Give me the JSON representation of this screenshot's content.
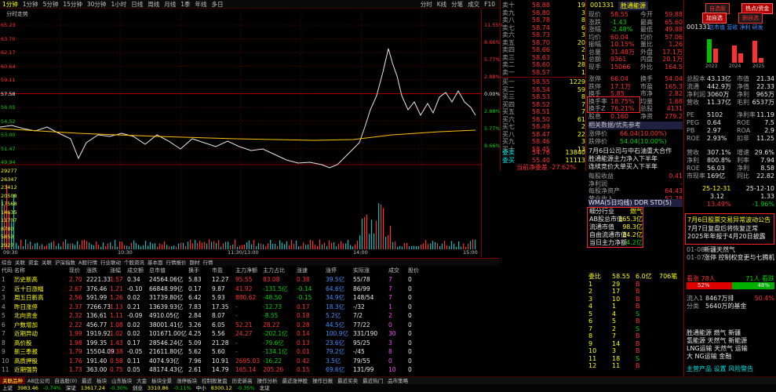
{
  "toolbar": {
    "left_items": [
      "1分钟",
      "1分钟",
      "5分钟",
      "15分钟",
      "30分钟",
      "1小时",
      "日线",
      "周线",
      "月线",
      "1季",
      "年线",
      "多日"
    ],
    "right_items": [
      "分时",
      "K线",
      "分笔",
      "成交",
      "F10"
    ]
  },
  "chart": {
    "ticker_label": "分时走势",
    "price_labels_left": [
      "65.23",
      "63.70",
      "62.17",
      "60.64",
      "59.11",
      "57.58",
      "56.05",
      "54.52",
      "53.00",
      "51.47",
      "49.94"
    ],
    "pct_labels_right": [
      "11.55%",
      "8.66%",
      "5.77%",
      "2.88%",
      "0.00%",
      "2.88%",
      "5.77%",
      "8.66%"
    ],
    "vol_labels_left": [
      "29277",
      "26347",
      "23412",
      "20508",
      "17568",
      "14635",
      "11707",
      "8780",
      "5853",
      "2927"
    ],
    "time_labels": [
      "09:30",
      "10:30",
      "11:30/13:00",
      "14:00",
      "15:00"
    ],
    "line_color": "#e8e8e8",
    "avg_color": "#ffc000"
  },
  "tabs_top": [
    "综合",
    "关联",
    "资金",
    "关联",
    "沪深指数",
    "A股行情",
    "行业联动",
    "个股资讯",
    "基本面",
    "行情报价",
    "题材",
    "行情"
  ],
  "table": {
    "headers": [
      "代码",
      "名称",
      "现价",
      "涨跌",
      "涨幅",
      "成交额",
      "总市值",
      "换手",
      "市盈",
      "主力净额",
      "主力占比",
      "涨速",
      "涨停",
      "实际涨",
      "成交",
      "股价"
    ],
    "rows": [
      [
        "1",
        "历史新高",
        "2.70",
        "2221.33",
        "1.57",
        "0.34",
        "24564.06亿",
        "5.83",
        "12.27",
        "95.55",
        "83.08",
        "0.38",
        "39.5亿",
        "55/78",
        "7",
        "0"
      ],
      [
        "2",
        "近十日涨幅",
        "2.67",
        "376.46",
        "1.21",
        "-0.10",
        "66848.99亿",
        "0.17",
        "9.87",
        "41.92",
        "-131.5亿",
        "-0.14",
        "64.6亿",
        "86/99",
        "7",
        "0"
      ],
      [
        "3",
        "周五日新高",
        "2.56",
        "591.99",
        "1.26",
        "0.02",
        "31739.80亿",
        "6.42",
        "5.93",
        "880.62",
        "-48.50",
        "-0.15",
        "34.9亿",
        "148/54",
        "7",
        "0"
      ],
      [
        "4",
        "昨日涨停",
        "2.37",
        "7266.73",
        "1.13",
        "0.21",
        "13639.93亿",
        "7.83",
        "17.35",
        "-",
        "-12.73",
        "0.17",
        "18.3亿",
        "-/32",
        "1",
        "0"
      ],
      [
        "5",
        "北向资金",
        "2.32",
        "136.61",
        "1.11",
        "-0.09",
        "4910.05亿",
        "2.84",
        "8.07",
        "-",
        "-8.55",
        "0.18",
        "5.2亿",
        "7/2",
        "2",
        "0"
      ],
      [
        "6",
        "户数增加",
        "2.22",
        "456.77",
        "1.08",
        "0.02",
        "38001.41亿",
        "3.26",
        "6.05",
        "52.21",
        "28.22",
        "0.28",
        "44.5亿",
        "77/22",
        "0",
        "0"
      ],
      [
        "7",
        "近期异动",
        "1.99",
        "1919.92",
        "1.02",
        "0.02",
        "101671.00亿",
        "4.25",
        "5.56",
        "24.27",
        "-202.1亿",
        "0.14",
        "100.9亿",
        "331/190",
        "30",
        "0"
      ],
      [
        "8",
        "高价股",
        "1.98",
        "199.35",
        "1.43",
        "0.17",
        "28546.24亿",
        "5.09",
        "21.28",
        "-",
        "-79.6亿",
        "0.13",
        "23.6亿",
        "95/25",
        "3",
        "0"
      ],
      [
        "9",
        "新三季报",
        "1.79",
        "15504.09",
        "1.38",
        "-0.05",
        "21611.80亿",
        "5.62",
        "5.60",
        "-",
        "-134.1亿",
        "0.01",
        "79.2亿",
        "-/45",
        "8",
        "0"
      ],
      [
        "10",
        "高质押股",
        "1.76",
        "191.40",
        "0.58",
        "0.11",
        "4074.93亿",
        "7.96",
        "10.91",
        "2695.03",
        "-16.22",
        "0.42",
        "3.5亿",
        "79/55",
        "0",
        "0"
      ],
      [
        "11",
        "近期强势",
        "1.73",
        "363.00",
        "0.75",
        "0.05",
        "48174.43亿",
        "2.61",
        "14.79",
        "165.14",
        "205.26",
        "0.15",
        "69.6亿",
        "131/99",
        "10",
        "0"
      ]
    ]
  },
  "bottom_tabs": [
    "关联品种",
    "AB比公司",
    "自选股(0)",
    "最近",
    "板块",
    "山东板块",
    "大金",
    "板块全景",
    "涨停板块",
    "控制股复盘",
    "历史新高",
    "操作分析",
    "最近涨停股",
    "操作日报",
    "最近买卖",
    "最近热门",
    "品市策略"
  ],
  "status": [
    "上证",
    "3983.46",
    "-0.74%",
    "深证",
    "13617.24",
    "-0.30%",
    "创业",
    "3310.86",
    "-0.11%",
    "中小",
    "8300.12",
    "-0.35%",
    "北证"
  ],
  "orderbook": {
    "sells": [
      {
        "label": "卖十",
        "price": "58.88",
        "vol": "19"
      },
      {
        "label": "卖九",
        "price": "58.80",
        "vol": "3"
      },
      {
        "label": "卖八",
        "price": "58.78",
        "vol": "8"
      },
      {
        "label": "卖七",
        "price": "58.74",
        "vol": "6"
      },
      {
        "label": "卖六",
        "price": "58.73",
        "vol": "3"
      },
      {
        "label": "卖五",
        "price": "58.70",
        "vol": "20"
      },
      {
        "label": "卖四",
        "price": "58.66",
        "vol": "2"
      },
      {
        "label": "卖三",
        "price": "58.63",
        "vol": "1"
      },
      {
        "label": "卖二",
        "price": "58.60",
        "vol": "28"
      },
      {
        "label": "卖一",
        "price": "58.57",
        "vol": "1"
      }
    ],
    "buys": [
      {
        "label": "买一",
        "price": "58.55",
        "vol": "1229"
      },
      {
        "label": "买二",
        "price": "58.54",
        "vol": "59"
      },
      {
        "label": "买三",
        "price": "58.53",
        "vol": "8"
      },
      {
        "label": "买四",
        "price": "58.52",
        "vol": "7"
      },
      {
        "label": "买五",
        "price": "58.51",
        "vol": "7"
      },
      {
        "label": "买六",
        "price": "58.50",
        "vol": "61"
      },
      {
        "label": "买七",
        "price": "58.49",
        "vol": "2"
      },
      {
        "label": "买八",
        "price": "58.47",
        "vol": "22"
      },
      {
        "label": "买九",
        "price": "58.46",
        "vol": "3"
      },
      {
        "label": "买十",
        "price": "58.45",
        "vol": "13"
      }
    ],
    "sum_sell": {
      "label": "委卖",
      "price": "54.76",
      "vol": "13840"
    },
    "sum_buy": {
      "label": "委买",
      "price": "55.40",
      "vol": "11113"
    },
    "net_label": "当前净委差",
    "net_value": "-27.62%"
  },
  "quote": {
    "code": "001331",
    "name": "胜通能源",
    "rows": [
      [
        "现价",
        "58.55",
        "今开",
        "59.88"
      ],
      [
        "涨跌",
        "-1.43",
        "最高",
        "65.60"
      ],
      [
        "涨幅",
        "-2.48%",
        "最低",
        "49.88"
      ],
      [
        "均价",
        "60.04",
        "均价",
        "57.06"
      ],
      [
        "振幅",
        "10.15%",
        "量比",
        "1.26"
      ],
      [
        "总量",
        "31.48万",
        "外盘",
        "17.1万"
      ],
      [
        "总额",
        "9361",
        "内盘",
        "20.1万"
      ],
      [
        "现手",
        "15066",
        "外比",
        "164.5"
      ]
    ],
    "rows2": [
      [
        "涨停",
        "66.04",
        "换手",
        "54.04"
      ],
      [
        "跌停",
        "17.1万",
        "市盈",
        "165.3"
      ],
      [
        "换手",
        "5.85",
        "市净",
        "2.82"
      ],
      [
        "换手率",
        "18.75%",
        "均量",
        "1.68"
      ],
      [
        "换手Z",
        "76.21%",
        "总股",
        "4131"
      ],
      [
        "股息",
        "0.160",
        "净资",
        "279.2"
      ]
    ],
    "limit_label": "涨停价",
    "limit_value": "66.04(10.00%)",
    "down_label": "跌停价",
    "down_value": "54.04(10.00%)",
    "related_label": "相关数据/优先参考",
    "news_rows": [
      "7月6日公司与中石油重大合作",
      "胜通能源主力净入下半年",
      "连续竞价大单买入下半年"
    ],
    "finance_rows": [
      [
        "每股收益",
        "0.41"
      ],
      [
        "净利润",
        "-"
      ],
      [
        "每股净资产",
        "64.43"
      ],
      [
        "营业收入",
        "52.78"
      ]
    ],
    "box_rows": [
      [
        "细分行业",
        "燃气"
      ],
      [
        "AB股总市值",
        "165.3亿"
      ],
      [
        "流通市值",
        "98.3亿"
      ],
      [
        "自由流通市值",
        "24.2亿"
      ],
      [
        "当日主力净额",
        "-4.2亿"
      ]
    ],
    "box_title": "WMA(5日均线) DDR STD(5)",
    "trade_rows": [
      [
        "委比",
        "58.55",
        "6.0亿",
        "706笔"
      ],
      [
        "1",
        "29",
        "B",
        ""
      ],
      [
        "2",
        "17",
        "B",
        ""
      ],
      [
        "3",
        "10",
        "B",
        ""
      ],
      [
        "4",
        "1",
        "B",
        ""
      ],
      [
        "5",
        "4",
        "S",
        ""
      ],
      [
        "6",
        "5",
        "B",
        ""
      ],
      [
        "7",
        "2",
        "S",
        ""
      ],
      [
        "8",
        "7",
        "B",
        ""
      ],
      [
        "9",
        "14",
        "B",
        ""
      ],
      [
        "10",
        "3",
        "B",
        ""
      ],
      [
        "11",
        "18",
        "S",
        ""
      ],
      [
        "12",
        "11",
        "B",
        ""
      ]
    ]
  },
  "right": {
    "btn_zhizhang": "自选股",
    "btn_add": "加自选",
    "btn_plan": "热点/资金",
    "btn_delete": "删自选",
    "code_line": "001331",
    "metrics_line": "总市值 营收 净利 研发",
    "bar_years": [
      "2023",
      "2024",
      "2025"
    ],
    "fund_rows": [
      [
        "总股本",
        "43.13亿",
        "市值",
        "21.34"
      ],
      [
        "流通",
        "442.9万",
        "净值",
        "22.33"
      ],
      [
        "净利润",
        "3060万",
        "净利",
        "965万"
      ],
      [
        "营收",
        "11.37亿",
        "毛利",
        "6537万"
      ]
    ],
    "pe_rows": [
      [
        "PE",
        "5102",
        "净利率",
        "11.19"
      ],
      [
        "PEG",
        "0.64",
        "ROE",
        "7.5"
      ],
      [
        "PB",
        "2.97",
        "ROA",
        "2.9"
      ],
      [
        "ROE",
        "2.93%",
        "扣非",
        "11.25"
      ]
    ],
    "growth_rows": [
      [
        "营收",
        "307.1%",
        "增速",
        "29.6%"
      ],
      [
        "净利",
        "800.8%",
        "利率",
        "7.94"
      ],
      [
        "ROE",
        "56.03",
        "净利",
        "8.58"
      ],
      [
        "市现率",
        "169亿",
        "同比",
        "22.82"
      ]
    ],
    "date_row": [
      "25-12-31",
      "25-12-10"
    ],
    "price_row": [
      "3.12",
      "1.33"
    ],
    "pct_row": [
      "13.49%",
      "-1.96%"
    ],
    "announce_title": "7月6日股票交易异常波动公告",
    "announce_lines": [
      "7月7日复盘后将恢复正常",
      "2025年年报于4月20日披露"
    ],
    "event_rows": [
      [
        "01-08",
        "新疆天然气"
      ],
      [
        "01-07",
        "涨停 控制权变更与七腾机器"
      ]
    ],
    "holder_rows": [
      [
        "人均持股",
        "1325"
      ],
      [
        "人均持股数",
        "17.06亿"
      ],
      [
        "人均市值",
        "13.92万"
      ],
      [
        "机构持股",
        "5102.94"
      ],
      [
        "基金持股",
        "13/9万"
      ],
      [
        "QFII",
        "-669.7万"
      ],
      [
        "社保",
        "3364.8"
      ],
      [
        "券商",
        "40.88万"
      ],
      [
        "信托",
        "-0.48"
      ],
      [
        "其他",
        "53.46万"
      ],
      [
        "合计",
        "3.66亿"
      ],
      [
        "占比",
        "2.4元"
      ],
      [
        "总户数",
        "64"
      ]
    ],
    "vote_up_label": "看涨 78人",
    "vote_down_label": "71人 看跌",
    "vote_up_pct": "52%",
    "vote_down_pct": "48%",
    "rank_rows": [
      [
        "流入1",
        "8467万排",
        "50.4%"
      ],
      [
        "分类",
        "5640万的基金",
        ""
      ]
    ],
    "concept_rows": [
      "胜通能源 燃气 新疆",
      "氢能源 天然气 新能源",
      "LNG运输 天然气 运输",
      "大 NG运输 金融"
    ],
    "footer": "主营产品 设置 风险警告"
  }
}
